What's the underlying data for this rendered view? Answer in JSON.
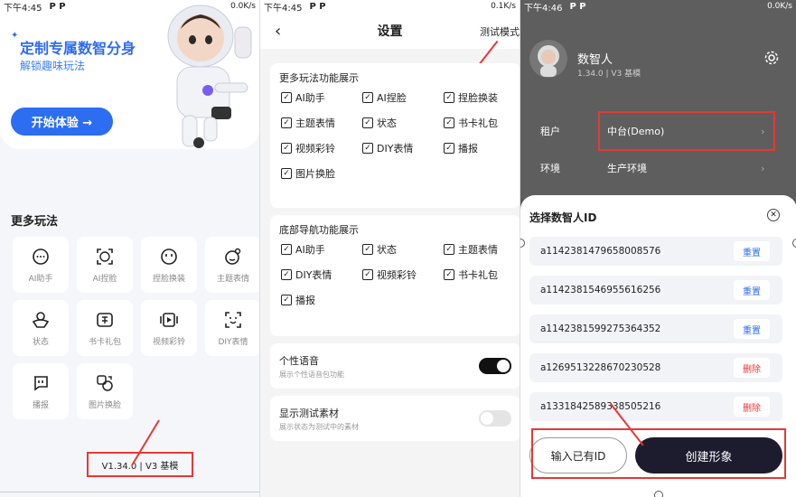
{
  "panel1": {
    "status_time": "下午4:45",
    "status_icons": "P P",
    "status_right": "0.0K/s",
    "hero_title": "定制专属数智分身",
    "hero_subtitle": "解锁趣味玩法",
    "start_button": "开始体验 →",
    "section_title": "更多玩法",
    "tiles": [
      {
        "label": "AI助手",
        "icon": "chat-bubble-icon"
      },
      {
        "label": "AI捏脸",
        "icon": "face-scan-icon"
      },
      {
        "label": "捏脸换装",
        "icon": "face-icon"
      },
      {
        "label": "主题表情",
        "icon": "emoji-icon"
      },
      {
        "label": "状态",
        "icon": "person-status-icon"
      },
      {
        "label": "书卡礼包",
        "icon": "gift-card-icon"
      },
      {
        "label": "视频彩铃",
        "icon": "video-icon"
      },
      {
        "label": "DIY表情",
        "icon": "sticker-icon"
      },
      {
        "label": "播报",
        "icon": "broadcast-icon"
      },
      {
        "label": "图片换脸",
        "icon": "image-swap-icon"
      }
    ],
    "version": "V1.34.0 | V3 基模",
    "accent": "#2c6df2"
  },
  "panel2": {
    "status_time": "下午4:45",
    "status_icons": "P P",
    "status_right": "0.1K/s",
    "back": "‹",
    "title": "设置",
    "test_mode": "测试模式",
    "section1": {
      "title": "更多玩法功能展示",
      "items": [
        "AI助手",
        "AI捏脸",
        "捏脸换装",
        "主题表情",
        "状态",
        "书卡礼包",
        "视频彩铃",
        "DIY表情",
        "播报",
        "图片换脸"
      ]
    },
    "section2": {
      "title": "底部导航功能展示",
      "items": [
        "AI助手",
        "状态",
        "主题表情",
        "DIY表情",
        "视频彩铃",
        "书卡礼包",
        "播报"
      ]
    },
    "voice": {
      "title": "个性语音",
      "subtitle": "展示个性语音包功能",
      "on": true
    },
    "test_material": {
      "title": "显示测试素材",
      "subtitle": "展示状态为测试中的素材",
      "on": false
    }
  },
  "panel3": {
    "status_time": "下午4:46",
    "status_icons": "P P",
    "status_right": "0.0K/s",
    "name": "数智人",
    "version": "1.34.0 | V3 基模",
    "tenant_label": "租户",
    "tenant_value": "中台(Demo)",
    "env_label": "环境",
    "env_value": "生产环境",
    "sheet_title": "选择数智人ID",
    "ids": [
      {
        "id": "a1142381479658008576",
        "action": "重置",
        "color": "#2c6df2"
      },
      {
        "id": "a1142381546955616256",
        "action": "重置",
        "color": "#2c6df2"
      },
      {
        "id": "a1142381599275364352",
        "action": "重置",
        "color": "#2c6df2"
      },
      {
        "id": "a1269513228670230528",
        "action": "删除",
        "color": "#e53935"
      },
      {
        "id": "a1331842589338505216",
        "action": "删除",
        "color": "#e53935"
      }
    ],
    "input_button": "输入已有ID",
    "create_button": "创建形象"
  }
}
